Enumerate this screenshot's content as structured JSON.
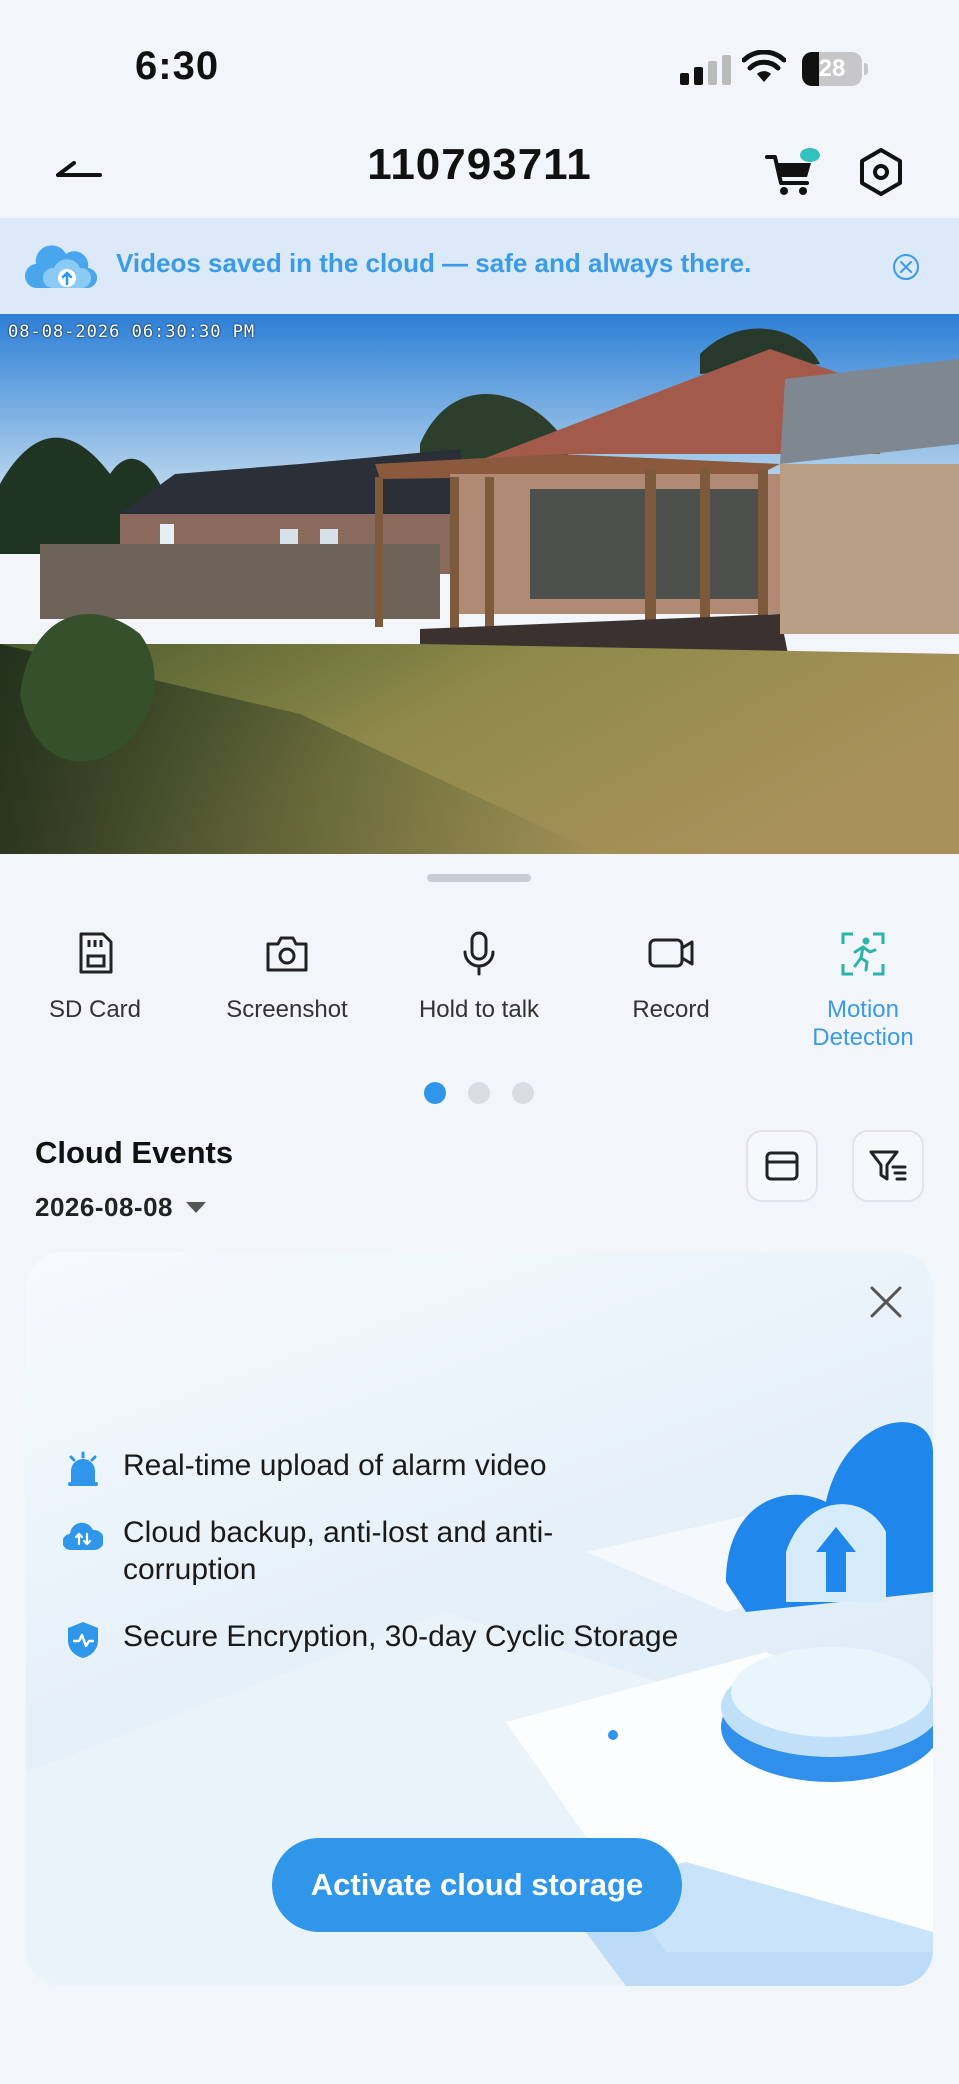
{
  "status_bar": {
    "time": "6:30",
    "battery": "28",
    "battery_level": 0.28
  },
  "header": {
    "title": "110793711"
  },
  "banner": {
    "text": "Videos saved in the cloud — safe and always there."
  },
  "live_view": {
    "timestamp": "08-08-2026 06:30:30 PM"
  },
  "controls": [
    {
      "label": "SD Card",
      "icon": "sd-card-icon"
    },
    {
      "label": "Screenshot",
      "icon": "camera-icon"
    },
    {
      "label": "Hold to talk",
      "icon": "microphone-icon"
    },
    {
      "label": "Record",
      "icon": "video-camera-icon"
    },
    {
      "label": "Motion\nDetection",
      "icon": "motion-detection-icon",
      "active": true
    }
  ],
  "pager": {
    "pages": 3,
    "current": 1
  },
  "events": {
    "title": "Cloud Events",
    "date": "2026-08-08"
  },
  "promo": {
    "features": [
      {
        "text": "Real-time upload of alarm video",
        "icon": "alarm-icon"
      },
      {
        "text": "Cloud backup, anti-lost and anti-corruption",
        "icon": "cloud-backup-icon"
      },
      {
        "text": "Secure Encryption, 30-day Cyclic Storage",
        "icon": "shield-icon"
      }
    ],
    "button": "Activate cloud storage"
  },
  "colors": {
    "accent": "#2f96ea",
    "banner_bg": "#dbe9f8",
    "background": "#f2f5fa"
  }
}
